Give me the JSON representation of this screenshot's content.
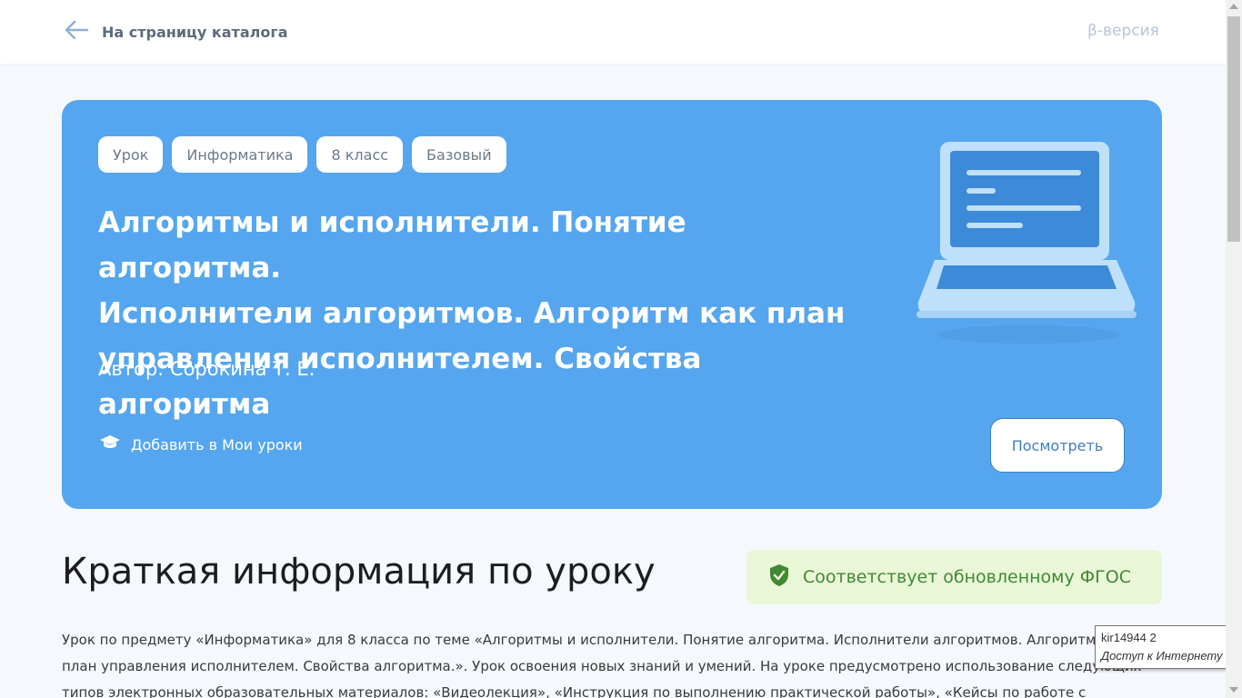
{
  "header": {
    "back_label": "На страницу каталога",
    "beta_label": "β-версия"
  },
  "hero": {
    "tags": [
      "Урок",
      "Информатика",
      "8 класс",
      "Базовый"
    ],
    "title_lines": [
      "Алгоритмы и исполнители. Понятие алгоритма.",
      "Исполнители алгоритмов. Алгоритм как план",
      "управления исполнителем. Свойства алгоритма"
    ],
    "author": "Автор: Сорокина Т. Е.",
    "add_label": "Добавить в Мои уроки",
    "view_button": "Посмотреть",
    "illustration_icon": "laptop-icon"
  },
  "summary": {
    "title": "Краткая информация по уроку",
    "fgos_badge": "Соответствует обновленному ФГОС",
    "description_lines": [
      "Урок по предмету «Информатика» для 8 класса по теме «Алгоритмы и исполнители. Понятие алгоритма. Исполнители алгоритмов. Алгоритм как",
      "план управления исполнителем. Свойства алгоритма.». Урок освоения новых знаний и умений. На уроке предусмотрено использование следующих",
      "типов электронных образовательных материалов: «Видеолекция», «Инструкция по выполнению практической работы», «Кейсы по работе с"
    ]
  },
  "tooltip": {
    "line1": "kir14944  2",
    "line2": "Доступ к Интернету"
  },
  "colors": {
    "hero_bg": "#55a6ee",
    "page_bg": "#f5f9fd",
    "fgos_bg": "#eaf7d7",
    "fgos_text": "#3f8a33"
  }
}
